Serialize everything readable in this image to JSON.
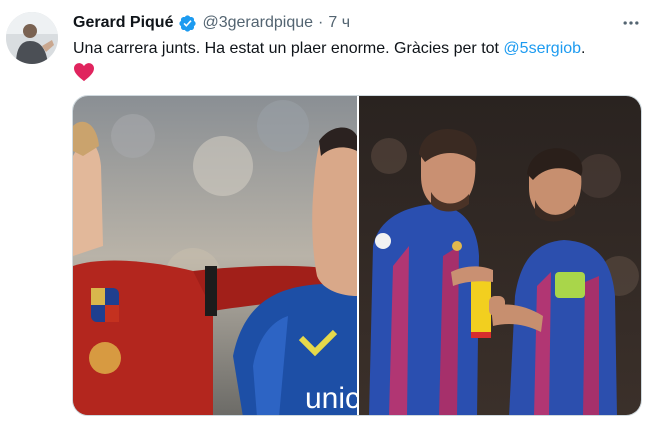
{
  "tweet": {
    "author_name": "Gerard Piqué",
    "handle": "@3gerardpique",
    "separator": "·",
    "time": "7 ч",
    "text_before": "Una carrera junts. Ha estat un plaer enorme. Gràcies per tot ",
    "mention": "@5sergiob",
    "text_after": ".",
    "emoji": "red-heart",
    "more_icon": "more-horizontal-icon",
    "verified_icon": "verified-badge-icon",
    "verified_color": "#1d9bf0",
    "mention_color": "#1d9bf0",
    "media": [
      {
        "alt": "photo-left",
        "shirt_text": "unic"
      },
      {
        "alt": "photo-right"
      }
    ]
  }
}
